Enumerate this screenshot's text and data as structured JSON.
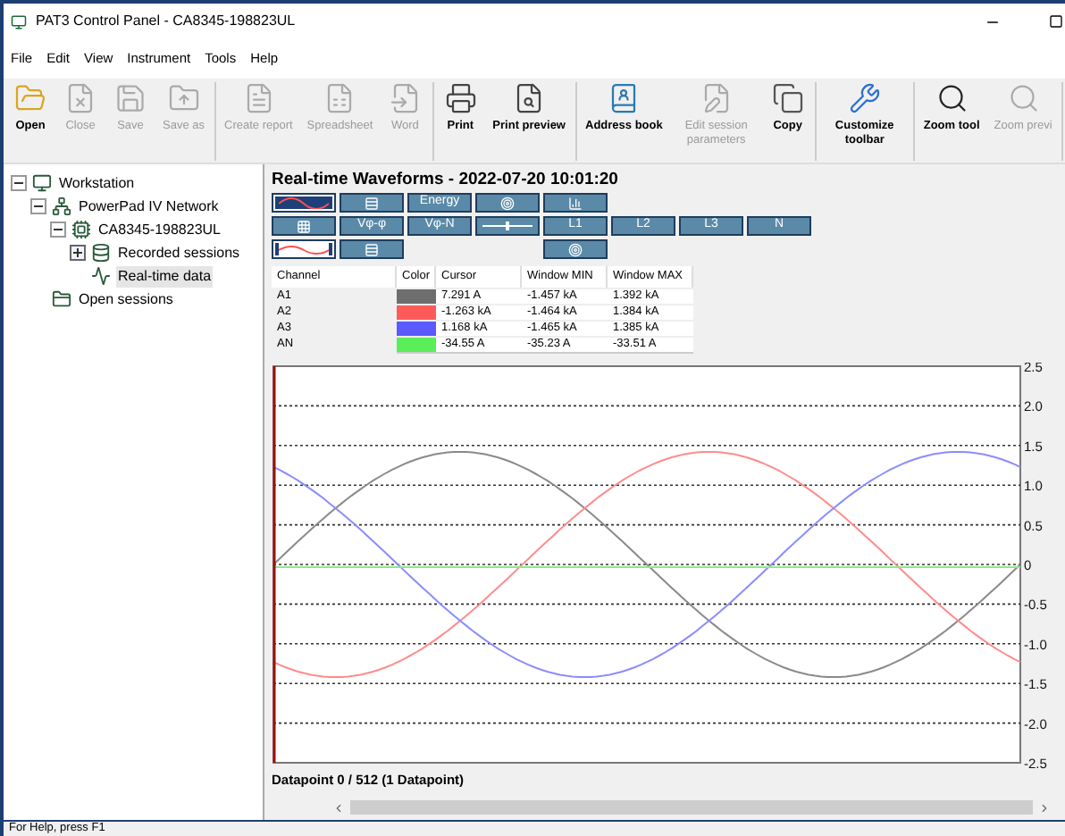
{
  "window": {
    "title": "PAT3 Control Panel - CA8345-198823UL"
  },
  "menu": [
    "File",
    "Edit",
    "View",
    "Instrument",
    "Tools",
    "Help"
  ],
  "toolbar": [
    [
      {
        "label": "Open",
        "disabled": false
      },
      {
        "label": "Close",
        "disabled": true
      },
      {
        "label": "Save",
        "disabled": true
      },
      {
        "label": "Save as",
        "disabled": true
      }
    ],
    [
      {
        "label": "Create report",
        "disabled": true
      },
      {
        "label": "Spreadsheet",
        "disabled": true
      },
      {
        "label": "Word",
        "disabled": true
      }
    ],
    [
      {
        "label": "Print",
        "disabled": false
      },
      {
        "label": "Print preview",
        "disabled": false
      }
    ],
    [
      {
        "label": "Address book",
        "disabled": false
      },
      {
        "label": "Edit session parameters",
        "disabled": true
      },
      {
        "label": "Copy",
        "disabled": false
      }
    ],
    [
      {
        "label": "Customize toolbar",
        "disabled": false
      }
    ],
    [
      {
        "label": "Zoom tool",
        "disabled": false
      },
      {
        "label": "Zoom previ",
        "disabled": true
      }
    ]
  ],
  "tree": [
    {
      "label": "Workstation",
      "kind": "station",
      "expanded": true,
      "selected": false,
      "children": [
        {
          "label": "PowerPad IV Network",
          "kind": "network",
          "expanded": true,
          "selected": false,
          "children": [
            {
              "label": "CA8345-198823UL",
              "kind": "device",
              "expanded": true,
              "selected": false,
              "children": [
                {
                  "label": "Recorded sessions",
                  "kind": "sessions",
                  "expanded": false,
                  "selected": false
                },
                {
                  "label": "Real-time data",
                  "kind": "realtime",
                  "selected": true
                }
              ]
            }
          ]
        },
        {
          "label": "Open sessions",
          "kind": "folder",
          "selected": false
        }
      ]
    }
  ],
  "panel": {
    "title": "Real-time Waveforms - 2022-07-20 10:01:20",
    "button_rows": [
      [
        {
          "kind": "wave",
          "selected": true
        },
        {
          "kind": "grid",
          "selected": false
        },
        {
          "kind": "text",
          "label": "Energy",
          "selected": false
        },
        {
          "kind": "phasor",
          "selected": false
        },
        {
          "kind": "bars",
          "selected": false
        }
      ],
      [
        {
          "kind": "meters",
          "selected": false
        },
        {
          "kind": "text",
          "label": "Vφ-φ",
          "selected": false
        },
        {
          "kind": "text",
          "label": "Vφ-N",
          "selected": false
        },
        {
          "kind": "slider",
          "selected": false
        },
        {
          "kind": "text",
          "label": "L1",
          "selected": false
        },
        {
          "kind": "text",
          "label": "L2",
          "selected": false
        },
        {
          "kind": "text",
          "label": "L3",
          "selected": false
        },
        {
          "kind": "text",
          "label": "N",
          "selected": false
        }
      ],
      [
        {
          "kind": "wavetext",
          "selected": true
        },
        {
          "kind": "grid",
          "selected": false
        },
        {
          "kind": "gap"
        },
        {
          "kind": "gap"
        },
        {
          "kind": "target",
          "selected": false
        }
      ]
    ],
    "table": {
      "columns": [
        "Channel",
        "Color",
        "Cursor",
        "Window MIN",
        "Window MAX"
      ],
      "rows": [
        {
          "channel": "A1",
          "color": "#6e6e6e",
          "cursor": "7.291 A",
          "min": "-1.457 kA",
          "max": "1.392 kA"
        },
        {
          "channel": "A2",
          "color": "#ff5a5a",
          "cursor": "-1.263 kA",
          "min": "-1.464 kA",
          "max": "1.384 kA"
        },
        {
          "channel": "A3",
          "color": "#5a5aff",
          "cursor": "1.168 kA",
          "min": "-1.465 kA",
          "max": "1.385 kA"
        },
        {
          "channel": "AN",
          "color": "#5aee5a",
          "cursor": "-34.55 A",
          "min": "-35.23 A",
          "max": "-33.51 A"
        }
      ]
    },
    "axis_labels": [
      "2.5",
      "2.0",
      "1.5",
      "1.0",
      "0.5",
      "0",
      "-0.5",
      "-1.0",
      "-1.5",
      "-2.0",
      "-2.5"
    ],
    "footer": "Datapoint 0 / 512 (1 Datapoint)"
  },
  "status_bar": "For Help, press F1"
}
